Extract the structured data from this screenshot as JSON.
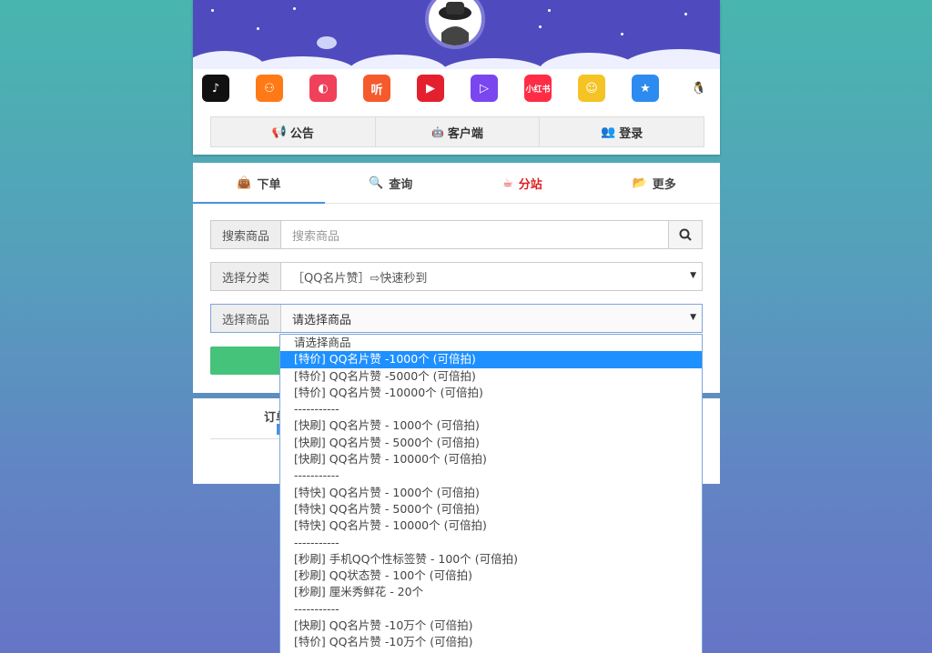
{
  "colors": {
    "accent": "#4a90e2",
    "banner": "#4f4bbf",
    "green": "#45c37b",
    "red": "#e02020",
    "selected": "#1e90ff"
  },
  "apps": [
    {
      "icon": "tiktok-icon",
      "bg": "#111",
      "glyph": "♪"
    },
    {
      "icon": "kuaishou-icon",
      "bg": "#ff7a16",
      "glyph": "⚇"
    },
    {
      "icon": "quanmin-icon",
      "bg": "#f0405a",
      "glyph": "◐"
    },
    {
      "icon": "ting-icon",
      "bg": "#f55a2c",
      "glyph": "听"
    },
    {
      "icon": "video-play-icon",
      "bg": "#e4202f",
      "glyph": "▶"
    },
    {
      "icon": "weishi-icon",
      "bg": "#7a46f0",
      "glyph": "▷"
    },
    {
      "icon": "xiaohongshu-icon",
      "bg": "#fe2c45",
      "glyph": "小红书"
    },
    {
      "icon": "cartoon-face-icon",
      "bg": "#f5c324",
      "glyph": "☺"
    },
    {
      "icon": "qzone-icon",
      "bg": "#2d8bf0",
      "glyph": "★"
    },
    {
      "icon": "qq-penguin-icon",
      "bg": "#fff",
      "glyph": "🐧"
    }
  ],
  "header": {
    "notice": "公告",
    "client": "客户端",
    "login": "登录"
  },
  "tabs": {
    "order": "下单",
    "query": "查询",
    "branch": "分站",
    "more": "更多"
  },
  "form": {
    "search_label": "搜索商品",
    "search_placeholder": "搜索商品",
    "category_label": "选择分类",
    "category_value": "［QQ名片赞］⇨快速秒到",
    "product_label": "选择商品",
    "product_value": "请选择商品"
  },
  "card2": {
    "label": "订单"
  },
  "dropdown": {
    "options": [
      "请选择商品",
      "[特价] QQ名片赞 -1000个 (可倍拍)",
      "[特价] QQ名片赞 -5000个 (可倍拍)",
      "[特价] QQ名片赞 -10000个 (可倍拍)",
      "-----------",
      "[快刷] QQ名片赞 - 1000个 (可倍拍)",
      "[快刷] QQ名片赞 - 5000个 (可倍拍)",
      "[快刷] QQ名片赞 - 10000个 (可倍拍)",
      "-----------",
      "[特快] QQ名片赞 - 1000个 (可倍拍)",
      "[特快] QQ名片赞 - 5000个 (可倍拍)",
      "[特快] QQ名片赞 - 10000个 (可倍拍)",
      "-----------",
      "[秒刷] 手机QQ个性标签赞 - 100个 (可倍拍)",
      "[秒刷] QQ状态赞 - 100个 (可倍拍)",
      "[秒刷] 厘米秀鲜花 - 20个",
      "-----------",
      "[快刷] QQ名片赞 -10万个 (可倍拍)",
      "[特价] QQ名片赞 -10万个 (可倍拍)"
    ],
    "selected_index": 1
  }
}
